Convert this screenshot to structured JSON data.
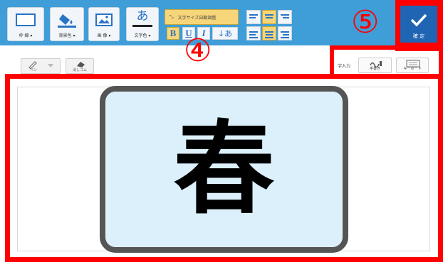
{
  "toolbar": {
    "frame_line_label": "枠 線 ▾",
    "background_color_label": "背景色 ▾",
    "image_label": "画 像 ▾",
    "text_color_glyph": "あ",
    "text_color_label": "文字色 ▾",
    "autosize_glyph": "⤡",
    "autosize_label": "文字サイズ自動調整",
    "bold": "B",
    "underline": "U",
    "italic": "I",
    "vertical_text": "↓あ"
  },
  "confirm": {
    "label": "確 定",
    "icon": "check-icon"
  },
  "tools": {
    "pen_label": "ペン",
    "eraser_label": "消しゴム"
  },
  "input_modes": {
    "text_input_label": "字入力",
    "handwriting_label": "手書き",
    "keyboard_label": "キーボード"
  },
  "card": {
    "character": "春"
  },
  "annotations": {
    "step4": "④",
    "step5": "⑤"
  },
  "colors": {
    "toolbar_bg": "#3f9ed7",
    "highlight": "#ff0000",
    "card_bg": "#dcf0fc",
    "confirm_bg": "#1f65b3"
  }
}
